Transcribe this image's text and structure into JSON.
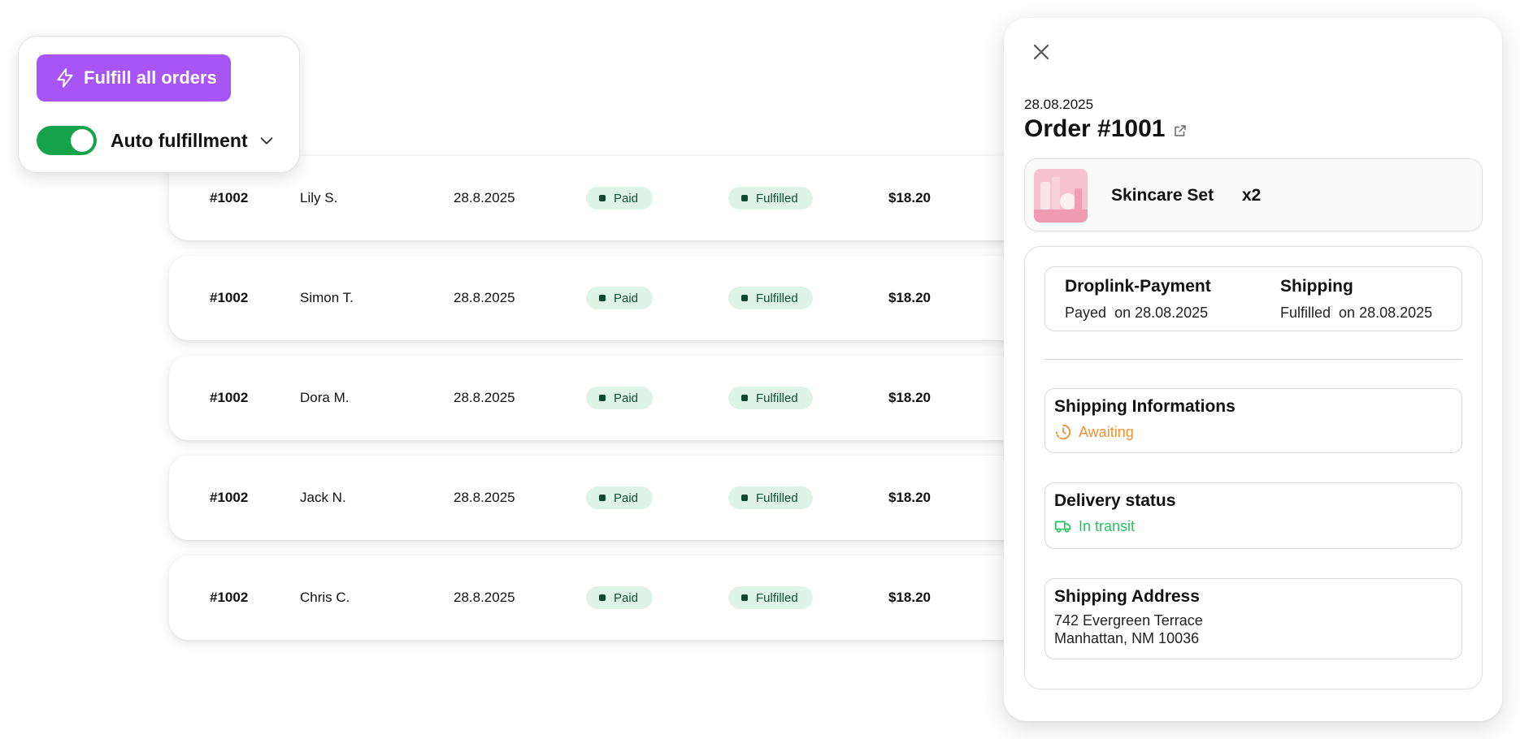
{
  "orders": {
    "rows": [
      {
        "id": "#1002",
        "name": "Lily S.",
        "date": "28.8.2025",
        "payment": "Paid",
        "fulfillment": "Fulfilled",
        "amount": "$18.20"
      },
      {
        "id": "#1002",
        "name": "Simon T.",
        "date": "28.8.2025",
        "payment": "Paid",
        "fulfillment": "Fulfilled",
        "amount": "$18.20"
      },
      {
        "id": "#1002",
        "name": "Dora M.",
        "date": "28.8.2025",
        "payment": "Paid",
        "fulfillment": "Fulfilled",
        "amount": "$18.20"
      },
      {
        "id": "#1002",
        "name": "Jack N.",
        "date": "28.8.2025",
        "payment": "Paid",
        "fulfillment": "Fulfilled",
        "amount": "$18.20"
      },
      {
        "id": "#1002",
        "name": "Chris C.",
        "date": "28.8.2025",
        "payment": "Paid",
        "fulfillment": "Fulfilled",
        "amount": "$18.20"
      }
    ]
  },
  "actions": {
    "fulfill_label": "Fulfill all orders",
    "fulfill_icon": "lightning-icon",
    "auto_label": "Auto fulfillment",
    "auto_enabled": true
  },
  "panel": {
    "date": "28.08.2025",
    "title": "Order #1001",
    "product": {
      "name": "Skincare Set",
      "qty": "x2"
    },
    "payment": {
      "title": "Droplink-Payment",
      "status": "Payed",
      "on_text": "on 28.08.2025"
    },
    "shipping": {
      "title": "Shipping",
      "status": "Fulfilled",
      "on_text": "on 28.08.2025"
    },
    "shipping_info": {
      "title": "Shipping Informations",
      "status": "Awaiting",
      "icon": "clock-icon"
    },
    "delivery": {
      "title": "Delivery status",
      "status": "In transit",
      "icon": "truck-icon"
    },
    "address": {
      "title": "Shipping Address",
      "line1": "742 Evergreen Terrace",
      "line2": "Manhattan, NM 10036"
    }
  },
  "colors": {
    "accent": "#a855f7",
    "toggle_on": "#16a34a",
    "badge_bg": "#ddf4e6",
    "awaiting": "#f5902d",
    "in_transit": "#22c55e"
  }
}
